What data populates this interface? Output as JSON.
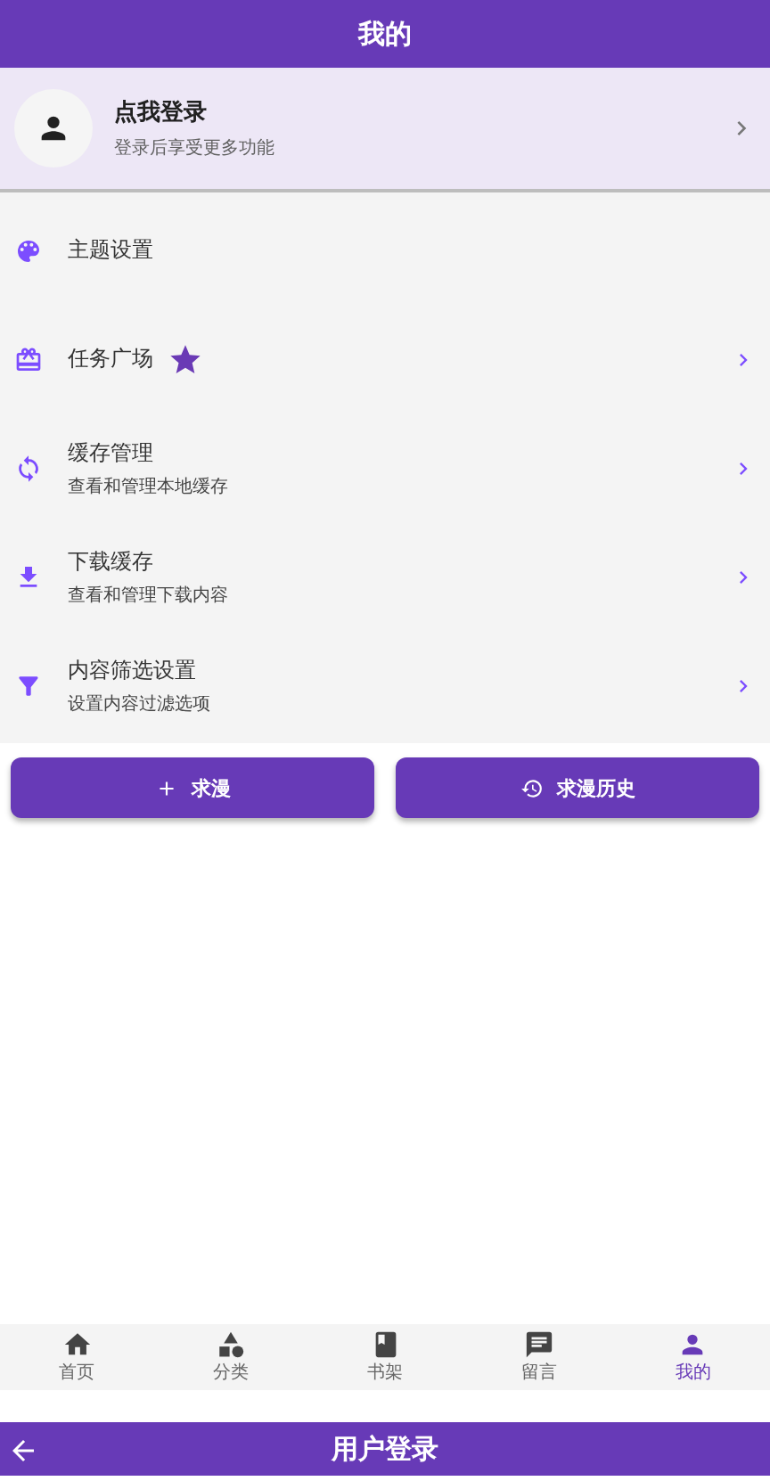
{
  "app_bar": {
    "title": "我的"
  },
  "profile": {
    "title": "点我登录",
    "subtitle": "登录后享受更多功能"
  },
  "menu": [
    {
      "kind": "palette",
      "label": "主题设置",
      "chevron": false,
      "starred": false
    },
    {
      "kind": "gift",
      "label": "任务广场",
      "chevron": true,
      "starred": true
    },
    {
      "kind": "sync",
      "label": "缓存管理",
      "subtitle": "查看和管理本地缓存",
      "chevron": true,
      "starred": false
    },
    {
      "kind": "download",
      "label": "下载缓存",
      "subtitle": "查看和管理下载内容",
      "chevron": true,
      "starred": false
    },
    {
      "kind": "filter",
      "label": "内容筛选设置",
      "subtitle": "设置内容过滤选项",
      "chevron": true,
      "starred": false
    }
  ],
  "buttons": [
    {
      "kind": "add",
      "label": "求漫"
    },
    {
      "kind": "history",
      "label": "求漫历史"
    }
  ],
  "bottom_nav": [
    {
      "kind": "home",
      "label": "首页",
      "selected": false
    },
    {
      "kind": "category",
      "label": "分类",
      "selected": false
    },
    {
      "kind": "book",
      "label": "书架",
      "selected": false
    },
    {
      "kind": "message",
      "label": "留言",
      "selected": false
    },
    {
      "kind": "person",
      "label": "我的",
      "selected": true
    }
  ],
  "next_app_bar": {
    "title": "用户登录"
  }
}
